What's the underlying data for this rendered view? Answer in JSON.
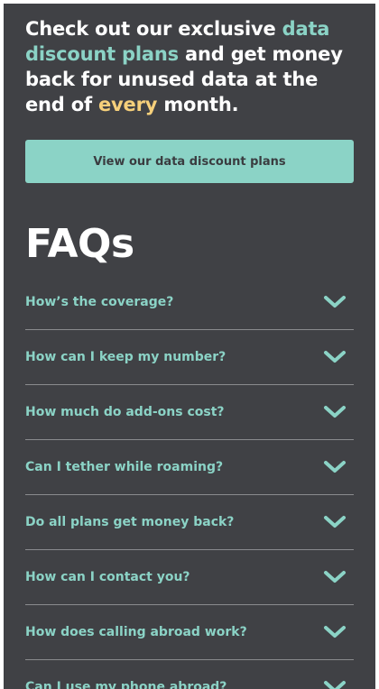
{
  "promo": {
    "part1": "Check out our exclusive ",
    "highlight1": "data discount plans",
    "part2": " and get money back for unused data at the end of ",
    "highlight2": "every",
    "part3": " month."
  },
  "cta": {
    "label": "View our data discount plans"
  },
  "faq": {
    "title": "FAQs",
    "questions": [
      "How’s the coverage?",
      "How can I keep my number?",
      "How much do add-ons cost?",
      "Can I tether while roaming?",
      "Do all plans get money back?",
      "How can I contact you?",
      "How does calling abroad work?",
      "Can I use my phone abroad?"
    ]
  },
  "icons": {
    "expand": "chevron-down-icon"
  },
  "colors": {
    "background": "#404145",
    "accent_teal": "#8bd3c6",
    "accent_yellow": "#f6d07b",
    "text": "#ffffff",
    "divider": "#8a8b8e"
  }
}
